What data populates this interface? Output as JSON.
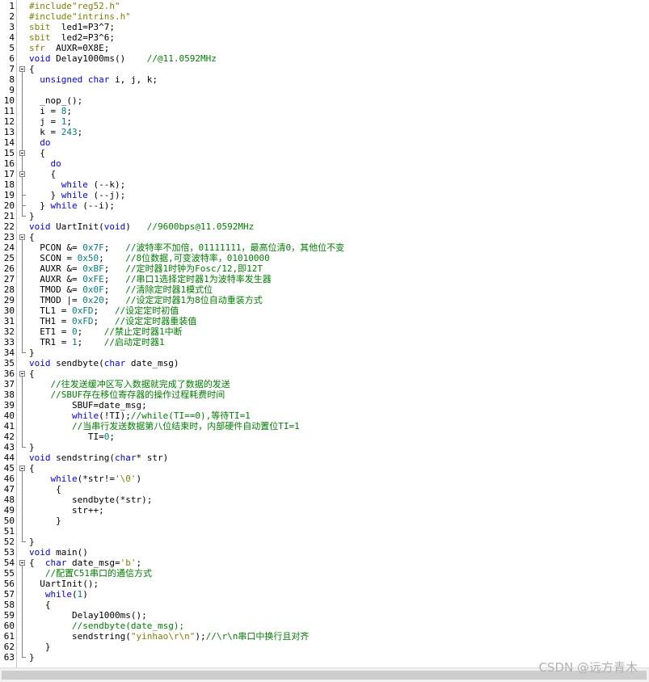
{
  "lines": [
    {
      "n": "1",
      "segs": [
        [
          "pp",
          "#include\"reg52.h\""
        ]
      ]
    },
    {
      "n": "2",
      "segs": [
        [
          "pp",
          "#include\"intrins.h\""
        ]
      ]
    },
    {
      "n": "3",
      "segs": [
        [
          "pp",
          "sbit"
        ],
        [
          "",
          "  led1=P3^7;"
        ]
      ]
    },
    {
      "n": "4",
      "segs": [
        [
          "pp",
          "sbit"
        ],
        [
          "",
          "  led2=P3^6;"
        ]
      ]
    },
    {
      "n": "5",
      "segs": [
        [
          "pp",
          "sfr"
        ],
        [
          "",
          "  AUXR=0X8E;"
        ]
      ]
    },
    {
      "n": "6",
      "segs": [
        [
          "kw",
          "void"
        ],
        [
          "",
          " Delay1000ms()    "
        ],
        [
          "cm",
          "//@11.0592MHz"
        ]
      ]
    },
    {
      "n": "7",
      "segs": [
        [
          "",
          "{"
        ]
      ]
    },
    {
      "n": "8",
      "segs": [
        [
          "",
          "  "
        ],
        [
          "kw",
          "unsigned char"
        ],
        [
          "",
          " i, j, k;"
        ]
      ]
    },
    {
      "n": "9",
      "segs": []
    },
    {
      "n": "10",
      "segs": [
        [
          "",
          "  _nop_();"
        ]
      ]
    },
    {
      "n": "11",
      "segs": [
        [
          "",
          "  i = "
        ],
        [
          "num",
          "8"
        ],
        [
          "",
          ";"
        ]
      ]
    },
    {
      "n": "12",
      "segs": [
        [
          "",
          "  j = "
        ],
        [
          "num",
          "1"
        ],
        [
          "",
          ";"
        ]
      ]
    },
    {
      "n": "13",
      "segs": [
        [
          "",
          "  k = "
        ],
        [
          "num",
          "243"
        ],
        [
          "",
          ";"
        ]
      ]
    },
    {
      "n": "14",
      "segs": [
        [
          "",
          "  "
        ],
        [
          "kw",
          "do"
        ]
      ]
    },
    {
      "n": "15",
      "segs": [
        [
          "",
          "  {"
        ]
      ]
    },
    {
      "n": "16",
      "segs": [
        [
          "",
          "    "
        ],
        [
          "kw",
          "do"
        ]
      ]
    },
    {
      "n": "17",
      "segs": [
        [
          "",
          "    {"
        ]
      ]
    },
    {
      "n": "18",
      "segs": [
        [
          "",
          "      "
        ],
        [
          "kw",
          "while"
        ],
        [
          "",
          " (--k);"
        ]
      ]
    },
    {
      "n": "19",
      "segs": [
        [
          "",
          "    } "
        ],
        [
          "kw",
          "while"
        ],
        [
          "",
          " (--j);"
        ]
      ]
    },
    {
      "n": "20",
      "segs": [
        [
          "",
          "  } "
        ],
        [
          "kw",
          "while"
        ],
        [
          "",
          " (--i);"
        ]
      ]
    },
    {
      "n": "21",
      "segs": [
        [
          "",
          "}"
        ]
      ]
    },
    {
      "n": "22",
      "segs": [
        [
          "kw",
          "void"
        ],
        [
          "",
          " UartInit("
        ],
        [
          "kw",
          "void"
        ],
        [
          "",
          ")   "
        ],
        [
          "cm",
          "//9600bps@11.0592MHz"
        ]
      ]
    },
    {
      "n": "23",
      "segs": [
        [
          "",
          "{"
        ]
      ]
    },
    {
      "n": "24",
      "segs": [
        [
          "",
          "  PCON &= "
        ],
        [
          "num",
          "0x7F"
        ],
        [
          "",
          ";   "
        ],
        [
          "cm",
          "//波特率不加倍，01111111，最高位清0，其他位不变"
        ]
      ]
    },
    {
      "n": "25",
      "segs": [
        [
          "",
          "  SCON = "
        ],
        [
          "num",
          "0x50"
        ],
        [
          "",
          ";    "
        ],
        [
          "cm",
          "//8位数据,可变波特率，01010000"
        ]
      ]
    },
    {
      "n": "26",
      "segs": [
        [
          "",
          "  AUXR &= "
        ],
        [
          "num",
          "0xBF"
        ],
        [
          "",
          ";   "
        ],
        [
          "cm",
          "//定时器1时钟为Fosc/12,即12T"
        ]
      ]
    },
    {
      "n": "27",
      "segs": [
        [
          "",
          "  AUXR &= "
        ],
        [
          "num",
          "0xFE"
        ],
        [
          "",
          ";   "
        ],
        [
          "cm",
          "//串口1选择定时器1为波特率发生器"
        ]
      ]
    },
    {
      "n": "28",
      "segs": [
        [
          "",
          "  TMOD &= "
        ],
        [
          "num",
          "0x0F"
        ],
        [
          "",
          ";   "
        ],
        [
          "cm",
          "//清除定时器1模式位"
        ]
      ]
    },
    {
      "n": "29",
      "segs": [
        [
          "",
          "  TMOD |= "
        ],
        [
          "num",
          "0x20"
        ],
        [
          "",
          ";   "
        ],
        [
          "cm",
          "//设定定时器1为8位自动重装方式"
        ]
      ]
    },
    {
      "n": "30",
      "segs": [
        [
          "",
          "  TL1 = "
        ],
        [
          "num",
          "0xFD"
        ],
        [
          "",
          ";   "
        ],
        [
          "cm",
          "//设定定时初值"
        ]
      ]
    },
    {
      "n": "31",
      "segs": [
        [
          "",
          "  TH1 = "
        ],
        [
          "num",
          "0xFD"
        ],
        [
          "",
          ";   "
        ],
        [
          "cm",
          "//设定定时器重装值"
        ]
      ]
    },
    {
      "n": "32",
      "segs": [
        [
          "",
          "  ET1 = "
        ],
        [
          "num",
          "0"
        ],
        [
          "",
          ";    "
        ],
        [
          "cm",
          "//禁止定时器1中断"
        ]
      ]
    },
    {
      "n": "33",
      "segs": [
        [
          "",
          "  TR1 = "
        ],
        [
          "num",
          "1"
        ],
        [
          "",
          ";    "
        ],
        [
          "cm",
          "//启动定时器1"
        ]
      ]
    },
    {
      "n": "34",
      "segs": [
        [
          "",
          "}"
        ]
      ]
    },
    {
      "n": "35",
      "segs": [
        [
          "kw",
          "void"
        ],
        [
          "",
          " sendbyte("
        ],
        [
          "kw",
          "char"
        ],
        [
          "",
          " date_msg)"
        ]
      ]
    },
    {
      "n": "36",
      "segs": [
        [
          "",
          "{"
        ]
      ]
    },
    {
      "n": "37",
      "segs": [
        [
          "",
          "    "
        ],
        [
          "cm",
          "//往发送缓冲区写入数据就完成了数据的发送"
        ]
      ]
    },
    {
      "n": "38",
      "segs": [
        [
          "",
          "    "
        ],
        [
          "cm",
          "//SBUF存在移位寄存器的操作过程耗费时间"
        ]
      ]
    },
    {
      "n": "39",
      "segs": [
        [
          "",
          "        SBUF=date_msg;"
        ]
      ]
    },
    {
      "n": "40",
      "segs": [
        [
          "",
          "        "
        ],
        [
          "kw",
          "while"
        ],
        [
          "",
          "(!TI);"
        ],
        [
          "cm",
          "//while(TI==0),等待TI=1"
        ]
      ]
    },
    {
      "n": "41",
      "segs": [
        [
          "",
          "        "
        ],
        [
          "cm",
          "//当串行发送数据第八位结束时，内部硬件自动置位TI=1"
        ]
      ]
    },
    {
      "n": "42",
      "segs": [
        [
          "",
          "           TI="
        ],
        [
          "num",
          "0"
        ],
        [
          "",
          ";"
        ]
      ]
    },
    {
      "n": "43",
      "segs": [
        [
          "",
          "}"
        ]
      ]
    },
    {
      "n": "44",
      "segs": [
        [
          "kw",
          "void"
        ],
        [
          "",
          " sendstring("
        ],
        [
          "kw",
          "char"
        ],
        [
          "",
          "* str)"
        ]
      ]
    },
    {
      "n": "45",
      "segs": [
        [
          "",
          "{"
        ]
      ]
    },
    {
      "n": "46",
      "segs": [
        [
          "",
          "    "
        ],
        [
          "kw",
          "while"
        ],
        [
          "",
          "(*str!="
        ],
        [
          "str",
          "'\\0'"
        ],
        [
          "",
          ")"
        ]
      ]
    },
    {
      "n": "47",
      "segs": [
        [
          "",
          "     {"
        ]
      ]
    },
    {
      "n": "48",
      "segs": [
        [
          "",
          "        sendbyte(*str);"
        ]
      ]
    },
    {
      "n": "49",
      "segs": [
        [
          "",
          "        str++;"
        ]
      ]
    },
    {
      "n": "50",
      "segs": [
        [
          "",
          "     }"
        ]
      ]
    },
    {
      "n": "51",
      "segs": []
    },
    {
      "n": "52",
      "segs": [
        [
          "",
          "}"
        ]
      ]
    },
    {
      "n": "53",
      "segs": [
        [
          "kw",
          "void"
        ],
        [
          "",
          " main()"
        ]
      ]
    },
    {
      "n": "54",
      "segs": [
        [
          "",
          "{  "
        ],
        [
          "kw",
          "char"
        ],
        [
          "",
          " date_msg="
        ],
        [
          "str",
          "'b'"
        ],
        [
          "",
          ";"
        ]
      ]
    },
    {
      "n": "55",
      "segs": [
        [
          "",
          "   "
        ],
        [
          "cm",
          "//配置C51串口的通信方式"
        ]
      ]
    },
    {
      "n": "56",
      "segs": [
        [
          "",
          "  UartInit();"
        ]
      ]
    },
    {
      "n": "57",
      "segs": [
        [
          "",
          "   "
        ],
        [
          "kw",
          "while"
        ],
        [
          "",
          "("
        ],
        [
          "num",
          "1"
        ],
        [
          "",
          ")"
        ]
      ]
    },
    {
      "n": "58",
      "segs": [
        [
          "",
          "   {"
        ]
      ]
    },
    {
      "n": "59",
      "segs": [
        [
          "",
          "        Delay1000ms();"
        ]
      ]
    },
    {
      "n": "60",
      "segs": [
        [
          "",
          "        "
        ],
        [
          "cm",
          "//sendbyte(date_msg);"
        ]
      ]
    },
    {
      "n": "61",
      "segs": [
        [
          "",
          "        sendstring("
        ],
        [
          "str",
          "\"yinhao\\r\\n\""
        ],
        [
          "",
          ");"
        ],
        [
          "cm",
          "//\\r\\n串口中换行且对齐"
        ]
      ]
    },
    {
      "n": "62",
      "segs": [
        [
          "",
          "   }"
        ]
      ]
    },
    {
      "n": "63",
      "segs": [
        [
          "",
          "}"
        ]
      ]
    }
  ],
  "watermark": "CSDN @远方青木"
}
